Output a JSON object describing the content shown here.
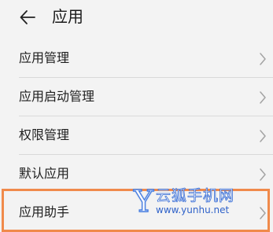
{
  "header": {
    "back_icon": "arrow-left-icon",
    "title": "应用"
  },
  "list": {
    "chevron_icon": "chevron-right-icon",
    "items": [
      {
        "label": "应用管理"
      },
      {
        "label": "应用启动管理"
      },
      {
        "label": "权限管理"
      },
      {
        "label": "默认应用"
      },
      {
        "label": "应用助手"
      }
    ]
  },
  "highlight": {
    "color": "#f08a4b"
  },
  "watermark": {
    "letter": "Y",
    "name": "云狐手机网",
    "url": "www.yunhu.net"
  }
}
